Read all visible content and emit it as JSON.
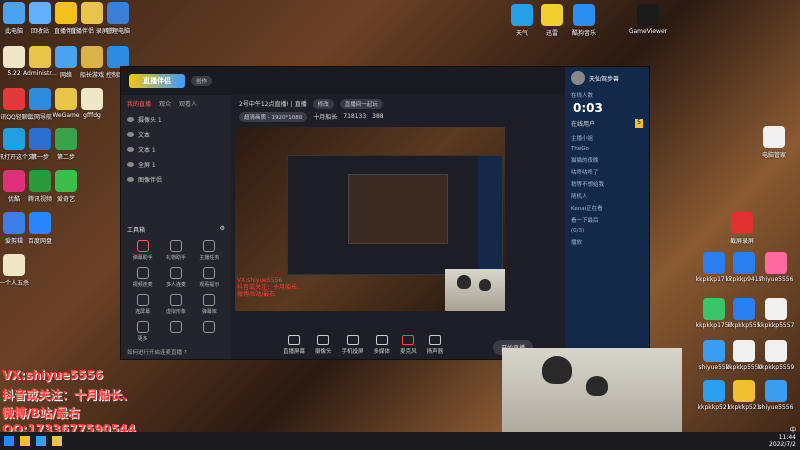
{
  "desktop": {
    "left_icons": [
      {
        "label": "此电脑",
        "color": "#4aa3f0"
      },
      {
        "label": "回收站",
        "color": "#5fb0ff"
      },
      {
        "label": "直播伴侣",
        "color": "#f2c21a"
      },
      {
        "label": "直播伴侣 录屏·视频",
        "color": "#e8c44a"
      },
      {
        "label": "管理电脑",
        "color": "#3b7ed8"
      },
      {
        "label": "5.22",
        "color": "#f0e6c8"
      },
      {
        "label": "Administr...",
        "color": "#e8c44a"
      },
      {
        "label": "网络",
        "color": "#4aa3f0"
      },
      {
        "label": "船长游戏",
        "color": "#d9b24a"
      },
      {
        "label": "控制面板",
        "color": "#2d8be0"
      },
      {
        "label": "腾讯QQ轻聊版",
        "color": "#e23a3a"
      },
      {
        "label": "上网导航",
        "color": "#2d8be0"
      },
      {
        "label": "WeGame",
        "color": "#e8c44a"
      },
      {
        "label": "gfffdg",
        "color": "#f0e6c8"
      },
      {
        "label": "腾讯打开这个文件 ",
        "color": "#20a0e0"
      },
      {
        "label": "第一步",
        "color": "#2a6fd0"
      },
      {
        "label": "第二步",
        "color": "#3aa34a"
      },
      {
        "label": "优酷",
        "color": "#e0307a"
      },
      {
        "label": "腾讯视频",
        "color": "#2b9a3c"
      },
      {
        "label": "爱奇艺",
        "color": "#3cbf4a"
      },
      {
        "label": "爱剪辑",
        "color": "#3d7ee8"
      },
      {
        "label": "百度网盘",
        "color": "#2a86ff"
      },
      {
        "label": "一个人五杀",
        "color": "#f0e6c8"
      }
    ],
    "top_right_icons": [
      {
        "label": "天气",
        "color": "#25a0e8"
      },
      {
        "label": "迅雷",
        "color": "#f0d030"
      },
      {
        "label": "酷狗音乐",
        "color": "#2a8ff0"
      },
      {
        "label": "GameViewer",
        "color": "#1a1a1a"
      }
    ],
    "right_icons": [
      {
        "label": "电脑管家",
        "color": "#f0f0f0"
      },
      {
        "label": "截屏录屏",
        "color": "#e03030"
      },
      {
        "label": "kkpkkp1717",
        "color": "#2a7ef0"
      },
      {
        "label": "kkpkkp9417",
        "color": "#2a7ef0"
      },
      {
        "label": "shiyue5556",
        "color": "#ff6aa0"
      },
      {
        "label": "kkpkkp1757",
        "color": "#3ac46a"
      },
      {
        "label": "kkpkkp555",
        "color": "#2a7ef0"
      },
      {
        "label": "kkpkkp5557",
        "color": "#f0f0f0"
      },
      {
        "label": "shiyue559",
        "color": "#3a9ef0"
      },
      {
        "label": "kkpkkp5559",
        "color": "#f0f0f0"
      },
      {
        "label": "kkpkkp5559",
        "color": "#f0f0f0"
      },
      {
        "label": "kkpkkp521",
        "color": "#2a9ef0"
      },
      {
        "label": "kkpkkp521",
        "color": "#f0c030"
      },
      {
        "label": "shiyue5556",
        "color": "#3a9ef0"
      }
    ]
  },
  "app": {
    "logo_text": "直播伴侣",
    "version_badge": "创作",
    "left_tabs": [
      "我的直播",
      "观众",
      "观看人"
    ],
    "sources": [
      "摄像头 1",
      "文本",
      "文本 1",
      "全屏 1",
      "图像伴侣"
    ],
    "tools_header": "工具箱",
    "tools": [
      "弹幕助手",
      "礼物助手",
      "主播任务",
      "视频连麦",
      "多人连麦",
      "观看提示",
      "连屏幕",
      "虚拟形象",
      "弹幕库",
      "更多",
      "",
      ""
    ],
    "help_text": "如何进行开启连麦直播 ?",
    "stream_title": "2号中午12点直播! | 直播",
    "title_tags": [
      "修改",
      "直播间一起玩"
    ],
    "resolution_tag": "超清画质 - 1920*1080",
    "stats": [
      "十月船长",
      "718133",
      "388"
    ],
    "bottom_buttons": [
      "直播屏幕",
      "摄像头",
      "手机投屏",
      "多媒体",
      "麦克风",
      "扬声器"
    ],
    "start_button": "开始直播",
    "right_user": "天仙驾步兽",
    "right_sub": "在线人数",
    "live_timer": "0:03",
    "right_list_title": "在线用户",
    "right_list_count": "5",
    "right_list": [
      "主播小姐",
      "TheGo",
      "猫猫的夜晚",
      "咕咚咕咚了",
      "稍等不想给我",
      "随机人",
      "Kenai正在看",
      "看一下最后",
      "(0/3)",
      "播放"
    ]
  },
  "overlay": {
    "line1": "VX:shiyue5556",
    "line2": "抖音或关注：十月船长、",
    "line3": "微博/B站/最右",
    "line4": "QQ:1733677590544"
  },
  "taskbar": {
    "time": "11:44",
    "date": "2022/7/2",
    "lang": "中"
  }
}
